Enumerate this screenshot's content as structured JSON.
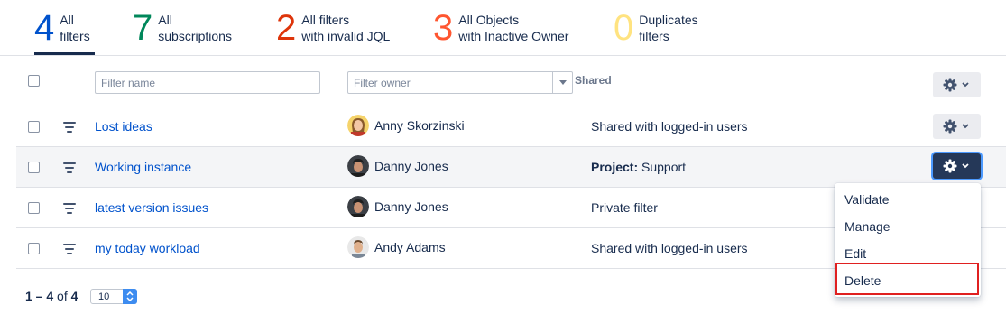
{
  "tabs": [
    {
      "count": "4",
      "line1": "All",
      "line2": "filters",
      "color": "#0052cc"
    },
    {
      "count": "7",
      "line1": "All",
      "line2": "subscriptions",
      "color": "#00875a"
    },
    {
      "count": "2",
      "line1": "All filters",
      "line2": "with invalid JQL",
      "color": "#de350b"
    },
    {
      "count": "3",
      "line1": "All Objects",
      "line2": "with Inactive Owner",
      "color": "#ff5630"
    },
    {
      "count": "0",
      "line1": "Duplicates",
      "line2": "filters",
      "color": "#ffe380"
    }
  ],
  "header": {
    "filter_name_placeholder": "Filter name",
    "filter_owner_placeholder": "Filter owner",
    "shared_column": "Shared"
  },
  "rows": [
    {
      "name": "Lost ideas",
      "owner": "Anny Skorzinski",
      "shared": "Shared with logged-in users",
      "shared_prefix": ""
    },
    {
      "name": "Working instance",
      "owner": "Danny Jones",
      "shared": "Support",
      "shared_prefix": "Project:"
    },
    {
      "name": "latest version issues",
      "owner": "Danny Jones",
      "shared": "Private filter",
      "shared_prefix": ""
    },
    {
      "name": "my today workload",
      "owner": "Andy Adams",
      "shared": "Shared with logged-in users",
      "shared_prefix": ""
    }
  ],
  "menu": {
    "items": [
      "Validate",
      "Manage",
      "Edit",
      "Delete"
    ],
    "highlighted": "Delete"
  },
  "pagination": {
    "range": "1 – 4",
    "of_label": "of",
    "total": "4",
    "page_size": "10"
  },
  "colors": {
    "link": "#0052cc",
    "active_button": "#253858",
    "highlight": "#e02020"
  }
}
